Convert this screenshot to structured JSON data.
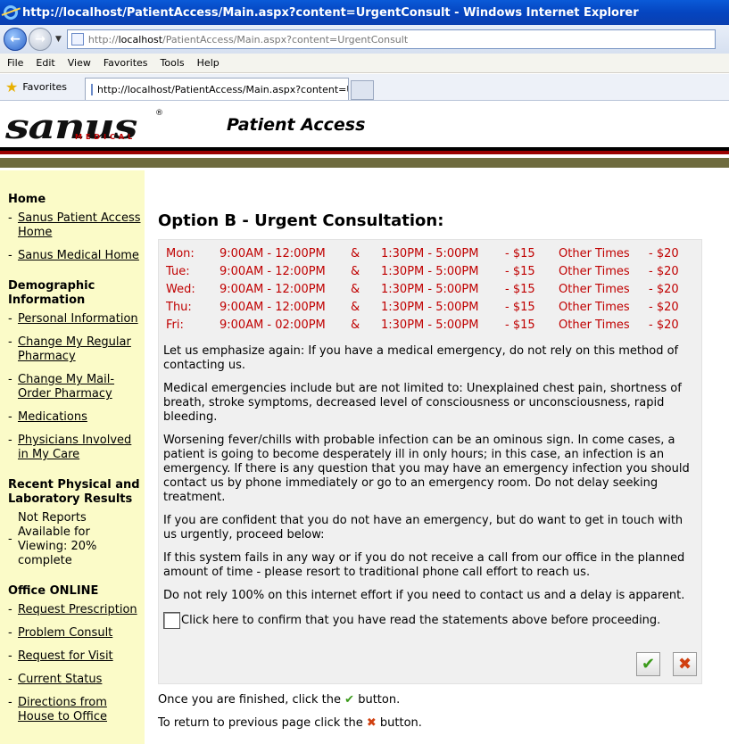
{
  "window": {
    "title": "http://localhost/PatientAccess/Main.aspx?content=UrgentConsult - Windows Internet Explorer"
  },
  "address": {
    "prefix": "http://",
    "host": "localhost",
    "path": "/PatientAccess/Main.aspx?content=UrgentConsult"
  },
  "menu": [
    "File",
    "Edit",
    "View",
    "Favorites",
    "Tools",
    "Help"
  ],
  "favorites": {
    "label": "Favorites",
    "tab_title": "http://localhost/PatientAccess/Main.aspx?content=Ur..."
  },
  "header": {
    "logo": "sanus",
    "logo_sub": "MEDICAL",
    "logo_reg": "®",
    "title": "Patient Access"
  },
  "sidebar": {
    "home_heading": "Home",
    "home_items": [
      "Sanus Patient Access Home",
      "Sanus Medical Home"
    ],
    "demo_heading": "Demographic Information",
    "demo_items": [
      "Personal Information",
      "Change My Regular Pharmacy",
      "Change My Mail-Order Pharmacy",
      "Medications",
      "Physicians Involved in My Care"
    ],
    "results_heading": "Recent Physical and Laboratory Results",
    "results_item": "Not Reports Available for Viewing: 20% complete",
    "office_heading": "Office ONLINE",
    "office_items": [
      "Request Prescription",
      "Problem Consult",
      "Request for Visit",
      "Current Status",
      "Directions from House to Office"
    ]
  },
  "main": {
    "title": "Option B - Urgent Consultation:",
    "schedule": [
      [
        "Mon:",
        "9:00AM - 12:00PM",
        "&",
        "1:30PM - 5:00PM",
        "- $15",
        "Other Times",
        "- $20"
      ],
      [
        "Tue:",
        "9:00AM - 12:00PM",
        "&",
        "1:30PM - 5:00PM",
        "- $15",
        "Other Times",
        "- $20"
      ],
      [
        "Wed:",
        "9:00AM - 12:00PM",
        "&",
        "1:30PM - 5:00PM",
        "- $15",
        "Other Times",
        "- $20"
      ],
      [
        "Thu:",
        "9:00AM - 12:00PM",
        "&",
        "1:30PM - 5:00PM",
        "- $15",
        "Other Times",
        "- $20"
      ],
      [
        "Fri:",
        "9:00AM - 02:00PM",
        "&",
        "1:30PM - 5:00PM",
        "- $15",
        "Other Times",
        "- $20"
      ]
    ],
    "paragraphs": [
      "Let us emphasize again:  If you have a medical emergency, do not rely on this method of contacting us.",
      "Medical emergencies include but are not limited to: Unexplained chest pain, shortness of breath, stroke symptoms, decreased level of consciousness or unconsciousness, rapid bleeding.",
      "Worsening fever/chills with probable infection can be an ominous sign.  In come cases, a patient is going to become desperately ill in only hours; in this case, an infection is an emergency.  If there is any question that you may have an emergency infection you should contact us by phone immediately or go to an emergency room.  Do not delay seeking treatment.",
      "If you are confident that you do not have an emergency, but do want to get in touch with us urgently, proceed below:",
      "If this system fails in any way or if you do not receive a call from our office in the planned amount of time - please resort to traditional phone call effort to reach us.",
      "Do not rely 100% on this internet effort if you need to contact us and a delay is apparent."
    ],
    "confirm_label": "Click here to confirm that you have read the statements above before proceeding.",
    "ok_glyph": "✔",
    "cancel_glyph": "✖",
    "finish_before": "Once you are finished, click the",
    "finish_after": "button.",
    "return_before": "To return to previous page click the",
    "return_after": "button."
  },
  "colors": {
    "schedule_text": "#c00000",
    "sidebar_bg": "#fbfbc8",
    "panel_bg": "#f0f0f0",
    "header_band": "#6e6b3e"
  }
}
